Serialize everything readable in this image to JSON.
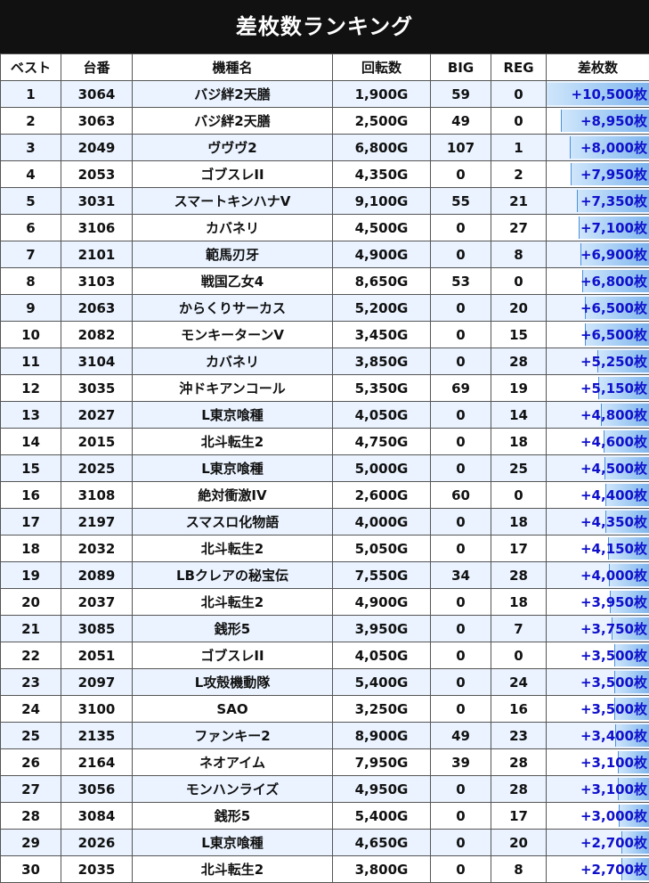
{
  "title": "差枚数ランキング",
  "headers": [
    "ベスト",
    "台番",
    "機種名",
    "回転数",
    "BIG",
    "REG",
    "差枚数"
  ],
  "max_diff": 10500,
  "rows": [
    {
      "rank": "1",
      "machine": "3064",
      "model": "バジ絆2天膳",
      "spins": "1,900G",
      "big": "59",
      "reg": "0",
      "diff": "+10,500枚",
      "diff_value": 10500
    },
    {
      "rank": "2",
      "machine": "3063",
      "model": "バジ絆2天膳",
      "spins": "2,500G",
      "big": "49",
      "reg": "0",
      "diff": "+8,950枚",
      "diff_value": 8950
    },
    {
      "rank": "3",
      "machine": "2049",
      "model": "ヴヴヴ2",
      "spins": "6,800G",
      "big": "107",
      "reg": "1",
      "diff": "+8,000枚",
      "diff_value": 8000
    },
    {
      "rank": "4",
      "machine": "2053",
      "model": "ゴブスレII",
      "spins": "4,350G",
      "big": "0",
      "reg": "2",
      "diff": "+7,950枚",
      "diff_value": 7950
    },
    {
      "rank": "5",
      "machine": "3031",
      "model": "スマートキンハナV",
      "spins": "9,100G",
      "big": "55",
      "reg": "21",
      "diff": "+7,350枚",
      "diff_value": 7350
    },
    {
      "rank": "6",
      "machine": "3106",
      "model": "カバネリ",
      "spins": "4,500G",
      "big": "0",
      "reg": "27",
      "diff": "+7,100枚",
      "diff_value": 7100
    },
    {
      "rank": "7",
      "machine": "2101",
      "model": "範馬刃牙",
      "spins": "4,900G",
      "big": "0",
      "reg": "8",
      "diff": "+6,900枚",
      "diff_value": 6900
    },
    {
      "rank": "8",
      "machine": "3103",
      "model": "戦国乙女4",
      "spins": "8,650G",
      "big": "53",
      "reg": "0",
      "diff": "+6,800枚",
      "diff_value": 6800
    },
    {
      "rank": "9",
      "machine": "2063",
      "model": "からくりサーカス",
      "spins": "5,200G",
      "big": "0",
      "reg": "20",
      "diff": "+6,500枚",
      "diff_value": 6500
    },
    {
      "rank": "10",
      "machine": "2082",
      "model": "モンキーターンV",
      "spins": "3,450G",
      "big": "0",
      "reg": "15",
      "diff": "+6,500枚",
      "diff_value": 6500
    },
    {
      "rank": "11",
      "machine": "3104",
      "model": "カバネリ",
      "spins": "3,850G",
      "big": "0",
      "reg": "28",
      "diff": "+5,250枚",
      "diff_value": 5250
    },
    {
      "rank": "12",
      "machine": "3035",
      "model": "沖ドキアンコール",
      "spins": "5,350G",
      "big": "69",
      "reg": "19",
      "diff": "+5,150枚",
      "diff_value": 5150
    },
    {
      "rank": "13",
      "machine": "2027",
      "model": "L東京喰種",
      "spins": "4,050G",
      "big": "0",
      "reg": "14",
      "diff": "+4,800枚",
      "diff_value": 4800
    },
    {
      "rank": "14",
      "machine": "2015",
      "model": "北斗転生2",
      "spins": "4,750G",
      "big": "0",
      "reg": "18",
      "diff": "+4,600枚",
      "diff_value": 4600
    },
    {
      "rank": "15",
      "machine": "2025",
      "model": "L東京喰種",
      "spins": "5,000G",
      "big": "0",
      "reg": "25",
      "diff": "+4,500枚",
      "diff_value": 4500
    },
    {
      "rank": "16",
      "machine": "3108",
      "model": "絶対衝激IV",
      "spins": "2,600G",
      "big": "60",
      "reg": "0",
      "diff": "+4,400枚",
      "diff_value": 4400
    },
    {
      "rank": "17",
      "machine": "2197",
      "model": "スマスロ化物語",
      "spins": "4,000G",
      "big": "0",
      "reg": "18",
      "diff": "+4,350枚",
      "diff_value": 4350
    },
    {
      "rank": "18",
      "machine": "2032",
      "model": "北斗転生2",
      "spins": "5,050G",
      "big": "0",
      "reg": "17",
      "diff": "+4,150枚",
      "diff_value": 4150
    },
    {
      "rank": "19",
      "machine": "2089",
      "model": "LBクレアの秘宝伝",
      "spins": "7,550G",
      "big": "34",
      "reg": "28",
      "diff": "+4,000枚",
      "diff_value": 4000
    },
    {
      "rank": "20",
      "machine": "2037",
      "model": "北斗転生2",
      "spins": "4,900G",
      "big": "0",
      "reg": "18",
      "diff": "+3,950枚",
      "diff_value": 3950
    },
    {
      "rank": "21",
      "machine": "3085",
      "model": "銭形5",
      "spins": "3,950G",
      "big": "0",
      "reg": "7",
      "diff": "+3,750枚",
      "diff_value": 3750
    },
    {
      "rank": "22",
      "machine": "2051",
      "model": "ゴブスレII",
      "spins": "4,050G",
      "big": "0",
      "reg": "0",
      "diff": "+3,500枚",
      "diff_value": 3500
    },
    {
      "rank": "23",
      "machine": "2097",
      "model": "L攻殻機動隊",
      "spins": "5,400G",
      "big": "0",
      "reg": "24",
      "diff": "+3,500枚",
      "diff_value": 3500
    },
    {
      "rank": "24",
      "machine": "3100",
      "model": "SAO",
      "spins": "3,250G",
      "big": "0",
      "reg": "16",
      "diff": "+3,500枚",
      "diff_value": 3500
    },
    {
      "rank": "25",
      "machine": "2135",
      "model": "ファンキー2",
      "spins": "8,900G",
      "big": "49",
      "reg": "23",
      "diff": "+3,400枚",
      "diff_value": 3400
    },
    {
      "rank": "26",
      "machine": "2164",
      "model": "ネオアイム",
      "spins": "7,950G",
      "big": "39",
      "reg": "28",
      "diff": "+3,100枚",
      "diff_value": 3100
    },
    {
      "rank": "27",
      "machine": "3056",
      "model": "モンハンライズ",
      "spins": "4,950G",
      "big": "0",
      "reg": "28",
      "diff": "+3,100枚",
      "diff_value": 3100
    },
    {
      "rank": "28",
      "machine": "3084",
      "model": "銭形5",
      "spins": "5,400G",
      "big": "0",
      "reg": "17",
      "diff": "+3,000枚",
      "diff_value": 3000
    },
    {
      "rank": "29",
      "machine": "2026",
      "model": "L東京喰種",
      "spins": "4,650G",
      "big": "0",
      "reg": "20",
      "diff": "+2,700枚",
      "diff_value": 2700
    },
    {
      "rank": "30",
      "machine": "2035",
      "model": "北斗転生2",
      "spins": "3,800G",
      "big": "0",
      "reg": "8",
      "diff": "+2,700枚",
      "diff_value": 2700
    }
  ]
}
